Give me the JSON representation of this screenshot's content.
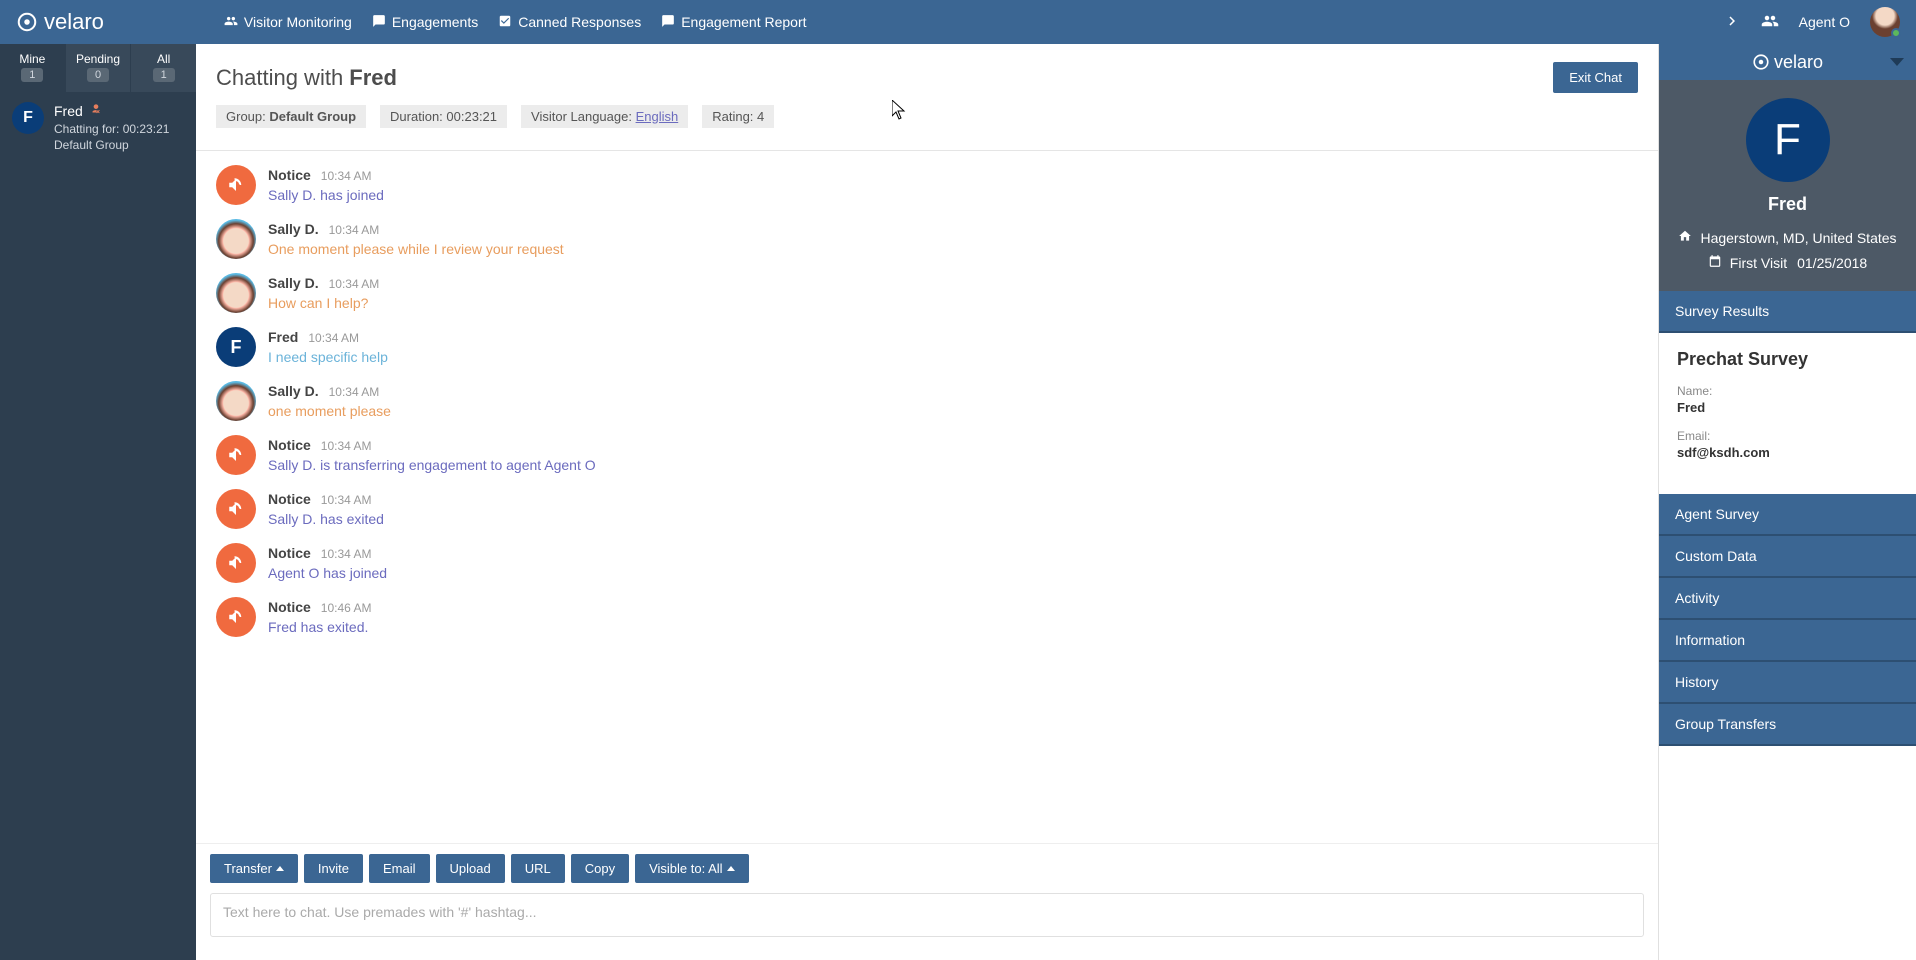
{
  "brand": "velaro",
  "nav": {
    "items": [
      {
        "label": "Visitor Monitoring",
        "icon": "users"
      },
      {
        "label": "Engagements",
        "icon": "chat"
      },
      {
        "label": "Canned Responses",
        "icon": "check"
      },
      {
        "label": "Engagement Report",
        "icon": "chat"
      }
    ]
  },
  "agent": {
    "name": "Agent O"
  },
  "leftTabs": [
    {
      "label": "Mine",
      "count": "1",
      "active": true
    },
    {
      "label": "Pending",
      "count": "0",
      "active": false
    },
    {
      "label": "All",
      "count": "1",
      "active": false
    }
  ],
  "chatList": [
    {
      "avatarLetter": "F",
      "name": "Fred",
      "line1": "Chatting for: 00:23:21",
      "line2": "Default Group",
      "exited": true
    }
  ],
  "chat": {
    "titlePrefix": "Chatting with ",
    "titleName": "Fred",
    "exitBtn": "Exit Chat",
    "meta": {
      "groupLabel": "Group: ",
      "groupValue": "Default Group",
      "durationLabel": "Duration: ",
      "durationValue": "00:23:21",
      "langLabel": "Visitor Language: ",
      "langValue": "English",
      "ratingLabel": "Rating: ",
      "ratingValue": "4"
    },
    "messages": [
      {
        "type": "notice",
        "sender": "Notice",
        "time": "10:34 AM",
        "text": "Sally D. has joined"
      },
      {
        "type": "agent",
        "sender": "Sally D.",
        "time": "10:34 AM",
        "text": "One moment please while I review your request"
      },
      {
        "type": "agent",
        "sender": "Sally D.",
        "time": "10:34 AM",
        "text": "How can I help?"
      },
      {
        "type": "visitor",
        "sender": "Fred",
        "time": "10:34 AM",
        "text": "I need specific help"
      },
      {
        "type": "agent",
        "sender": "Sally D.",
        "time": "10:34 AM",
        "text": "one moment please"
      },
      {
        "type": "notice",
        "sender": "Notice",
        "time": "10:34 AM",
        "text": "Sally D. is transferring engagement to agent Agent O"
      },
      {
        "type": "notice",
        "sender": "Notice",
        "time": "10:34 AM",
        "text": "Sally D. has exited"
      },
      {
        "type": "notice",
        "sender": "Notice",
        "time": "10:34 AM",
        "text": "Agent O has joined"
      },
      {
        "type": "notice",
        "sender": "Notice",
        "time": "10:46 AM",
        "text": "Fred has exited."
      }
    ],
    "actions": {
      "transfer": "Transfer",
      "invite": "Invite",
      "email": "Email",
      "upload": "Upload",
      "url": "URL",
      "copy": "Copy",
      "visibleTo": "Visible to: All"
    },
    "inputPlaceholder": "Text here to chat. Use premades with '#' hashtag..."
  },
  "right": {
    "visitor": {
      "avatarLetter": "F",
      "name": "Fred",
      "location": "Hagerstown, MD, United States",
      "firstVisitLabel": "First Visit",
      "firstVisitDate": "01/25/2018"
    },
    "accordion": {
      "surveyResults": "Survey Results",
      "prechat": {
        "title": "Prechat Survey",
        "nameLabel": "Name:",
        "nameValue": "Fred",
        "emailLabel": "Email:",
        "emailValue": "sdf@ksdh.com"
      },
      "agentSurvey": "Agent Survey",
      "customData": "Custom Data",
      "activity": "Activity",
      "information": "Information",
      "history": "History",
      "groupTransfers": "Group Transfers"
    }
  }
}
